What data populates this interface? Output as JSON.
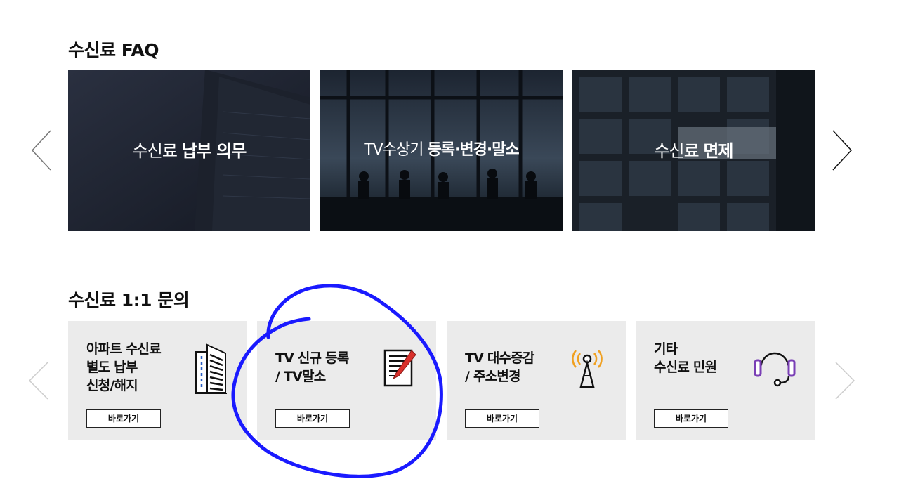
{
  "faq": {
    "title": "수신료 FAQ",
    "cards": [
      {
        "light": "수신료 ",
        "bold": "납부 의무"
      },
      {
        "light": "TV수상기 ",
        "bold": "등록·변경·말소"
      },
      {
        "light": "수신료 ",
        "bold": "면제"
      }
    ]
  },
  "inquiry": {
    "title": "수신료 1:1 문의",
    "cards": [
      {
        "text": "아파트 수신료\n별도 납부\n신청/해지",
        "icon": "apartment-building-icon",
        "button": "바로가기"
      },
      {
        "text": "TV 신규 등록\n/ TV말소",
        "icon": "document-pencil-icon",
        "button": "바로가기"
      },
      {
        "text": "TV 대수증감\n/ 주소변경",
        "icon": "broadcast-tower-icon",
        "button": "바로가기"
      },
      {
        "text": "기타\n수신료 민원",
        "icon": "headset-icon",
        "button": "바로가기"
      }
    ]
  },
  "colors": {
    "card_bg": "#ebebeb",
    "annotation": "#1a1aff",
    "pencil": "#d9302b",
    "tower_signal": "#f0a020",
    "headset": "#7a3fb5"
  }
}
